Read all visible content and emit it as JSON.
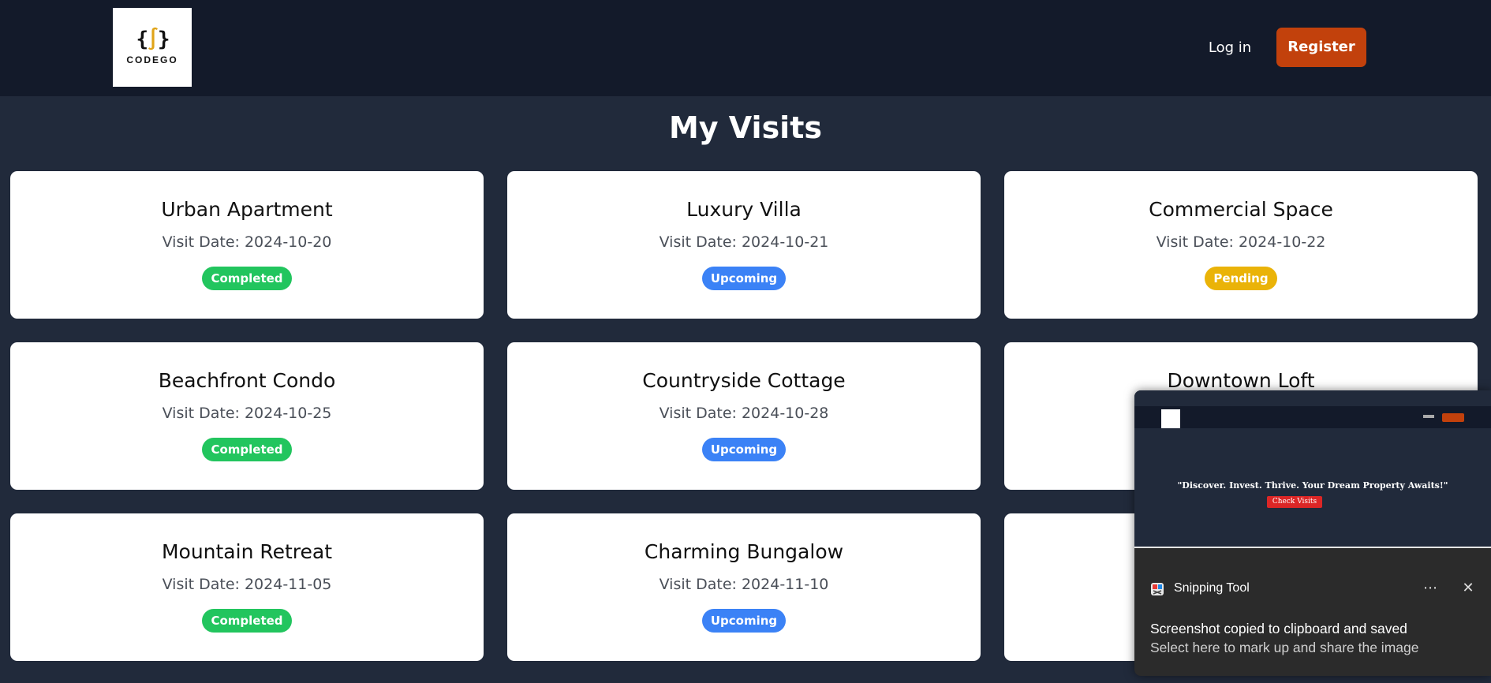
{
  "header": {
    "logo_text": "CODEGO",
    "login_label": "Log in",
    "register_label": "Register"
  },
  "page_title": "My Visits",
  "visits": [
    {
      "title": "Urban Apartment",
      "date": "Visit Date: 2024-10-20",
      "status": "Completed",
      "status_key": "completed"
    },
    {
      "title": "Luxury Villa",
      "date": "Visit Date: 2024-10-21",
      "status": "Upcoming",
      "status_key": "upcoming"
    },
    {
      "title": "Commercial Space",
      "date": "Visit Date: 2024-10-22",
      "status": "Pending",
      "status_key": "pending"
    },
    {
      "title": "Beachfront Condo",
      "date": "Visit Date: 2024-10-25",
      "status": "Completed",
      "status_key": "completed"
    },
    {
      "title": "Countryside Cottage",
      "date": "Visit Date: 2024-10-28",
      "status": "Upcoming",
      "status_key": "upcoming"
    },
    {
      "title": "Downtown Loft",
      "date": "",
      "status": "",
      "status_key": ""
    },
    {
      "title": "Mountain Retreat",
      "date": "Visit Date: 2024-11-05",
      "status": "Completed",
      "status_key": "completed"
    },
    {
      "title": "Charming Bungalow",
      "date": "Visit Date: 2024-11-10",
      "status": "Upcoming",
      "status_key": "upcoming"
    },
    {
      "title": "",
      "date": "",
      "status": "",
      "status_key": ""
    }
  ],
  "colors": {
    "header_bg": "#131a2a",
    "page_bg": "#212a3b",
    "register_bg": "#c2410c",
    "completed": "#22c55e",
    "upcoming": "#3b82f6",
    "pending": "#eab308"
  },
  "toast": {
    "preview_quote": "\"Discover. Invest. Thrive. Your Dream Property Awaits!\"",
    "preview_button": "Check Visits",
    "app_name": "Snipping Tool",
    "more_icon": "more-icon",
    "close_icon": "close-icon",
    "message": "Screenshot copied to clipboard and saved",
    "sub_message": "Select here to mark up and share the image"
  }
}
